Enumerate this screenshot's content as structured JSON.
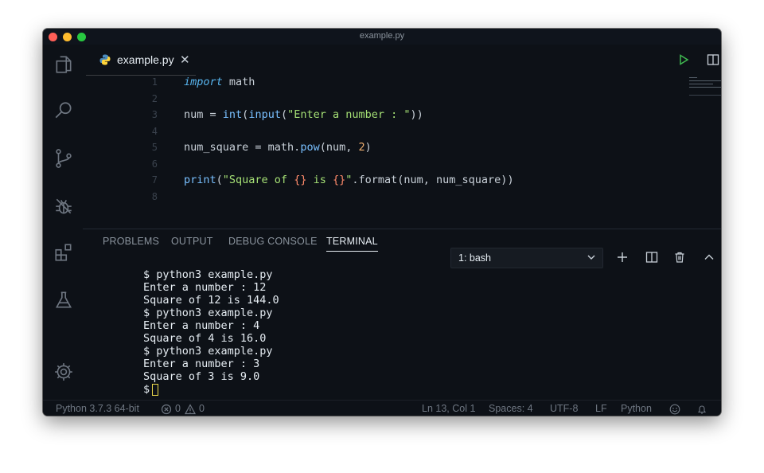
{
  "window": {
    "title": "example.py"
  },
  "tab": {
    "label": "example.py",
    "close": "✕"
  },
  "editor": {
    "lines": [
      {
        "n": "1",
        "parts": [
          [
            "kw",
            "import"
          ],
          [
            "plain",
            " math"
          ]
        ]
      },
      {
        "n": "2",
        "parts": []
      },
      {
        "n": "3",
        "parts": [
          [
            "plain",
            "num = "
          ],
          [
            "fn",
            "int"
          ],
          [
            "plain",
            "("
          ],
          [
            "fn",
            "input"
          ],
          [
            "plain",
            "("
          ],
          [
            "str",
            "\"Enter a number : \""
          ],
          [
            "plain",
            "))"
          ]
        ]
      },
      {
        "n": "4",
        "parts": []
      },
      {
        "n": "5",
        "parts": [
          [
            "plain",
            "num_square = math."
          ],
          [
            "fn",
            "pow"
          ],
          [
            "plain",
            "(num, "
          ],
          [
            "num",
            "2"
          ],
          [
            "plain",
            ")"
          ]
        ]
      },
      {
        "n": "6",
        "parts": []
      },
      {
        "n": "7",
        "parts": [
          [
            "fn",
            "print"
          ],
          [
            "plain",
            "("
          ],
          [
            "str",
            "\"Square of "
          ],
          [
            "brace",
            "{}"
          ],
          [
            "str",
            " is "
          ],
          [
            "brace",
            "{}"
          ],
          [
            "str",
            "\""
          ],
          [
            "plain",
            ".format(num, num_square))"
          ]
        ]
      },
      {
        "n": "8",
        "parts": []
      }
    ]
  },
  "panel": {
    "tabs": [
      "PROBLEMS",
      "OUTPUT",
      "DEBUG CONSOLE",
      "TERMINAL"
    ],
    "active_tab": "TERMINAL",
    "terminal_select": "1: bash",
    "terminal_lines": [
      "$ python3 example.py",
      "Enter a number : 12",
      "Square of 12 is 144.0",
      "$ python3 example.py",
      "Enter a number : 4",
      "Square of 4 is 16.0",
      "$ python3 example.py",
      "Enter a number : 3",
      "Square of 3 is 9.0"
    ],
    "prompt": "$"
  },
  "statusbar": {
    "python": "Python 3.7.3 64-bit",
    "errors": "0",
    "warnings": "0",
    "position": "Ln 13, Col 1",
    "spaces": "Spaces: 4",
    "encoding": "UTF-8",
    "eol": "LF",
    "language": "Python"
  },
  "colors": {
    "background": "#0d1117",
    "keyword": "#58b6f0",
    "string": "#a5e075",
    "number": "#f0b070",
    "run_button": "#3fb950",
    "cursor": "#e7d44a"
  },
  "icons": [
    "files-icon",
    "search-icon",
    "source-control-icon",
    "debug-icon",
    "extensions-icon",
    "flask-icon",
    "settings-gear-icon",
    "run-icon",
    "split-editor-icon",
    "more-actions-icon",
    "add-terminal-icon",
    "split-terminal-icon",
    "trash-icon",
    "maximize-panel-icon",
    "close-panel-icon",
    "feedback-smiley-icon",
    "notifications-bell-icon",
    "python-file-icon"
  ]
}
